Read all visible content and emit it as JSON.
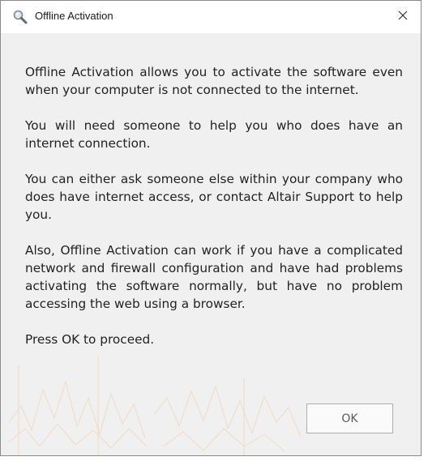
{
  "window": {
    "title": "Offline Activation"
  },
  "body": {
    "paragraphs": [
      "Offline Activation allows you to activate the software even when your computer is not connected to the internet.",
      "You will need someone to help you who does have an internet connection.",
      "You can either ask someone else within your company who does have internet access, or contact Altair Support to help you.",
      "Also, Offline Activation can work if you have a complicated network and firewall configuration and have had problems activating the software normally, but have no problem accessing the web using a browser.",
      "Press OK to proceed."
    ]
  },
  "buttons": {
    "ok_label": "OK"
  },
  "icons": {
    "title": "magnifier-icon",
    "close": "close-icon"
  },
  "colors": {
    "dialog_background": "#f0f0f0",
    "titlebar_background": "#ffffff",
    "watermark": "#f2c9a0"
  }
}
